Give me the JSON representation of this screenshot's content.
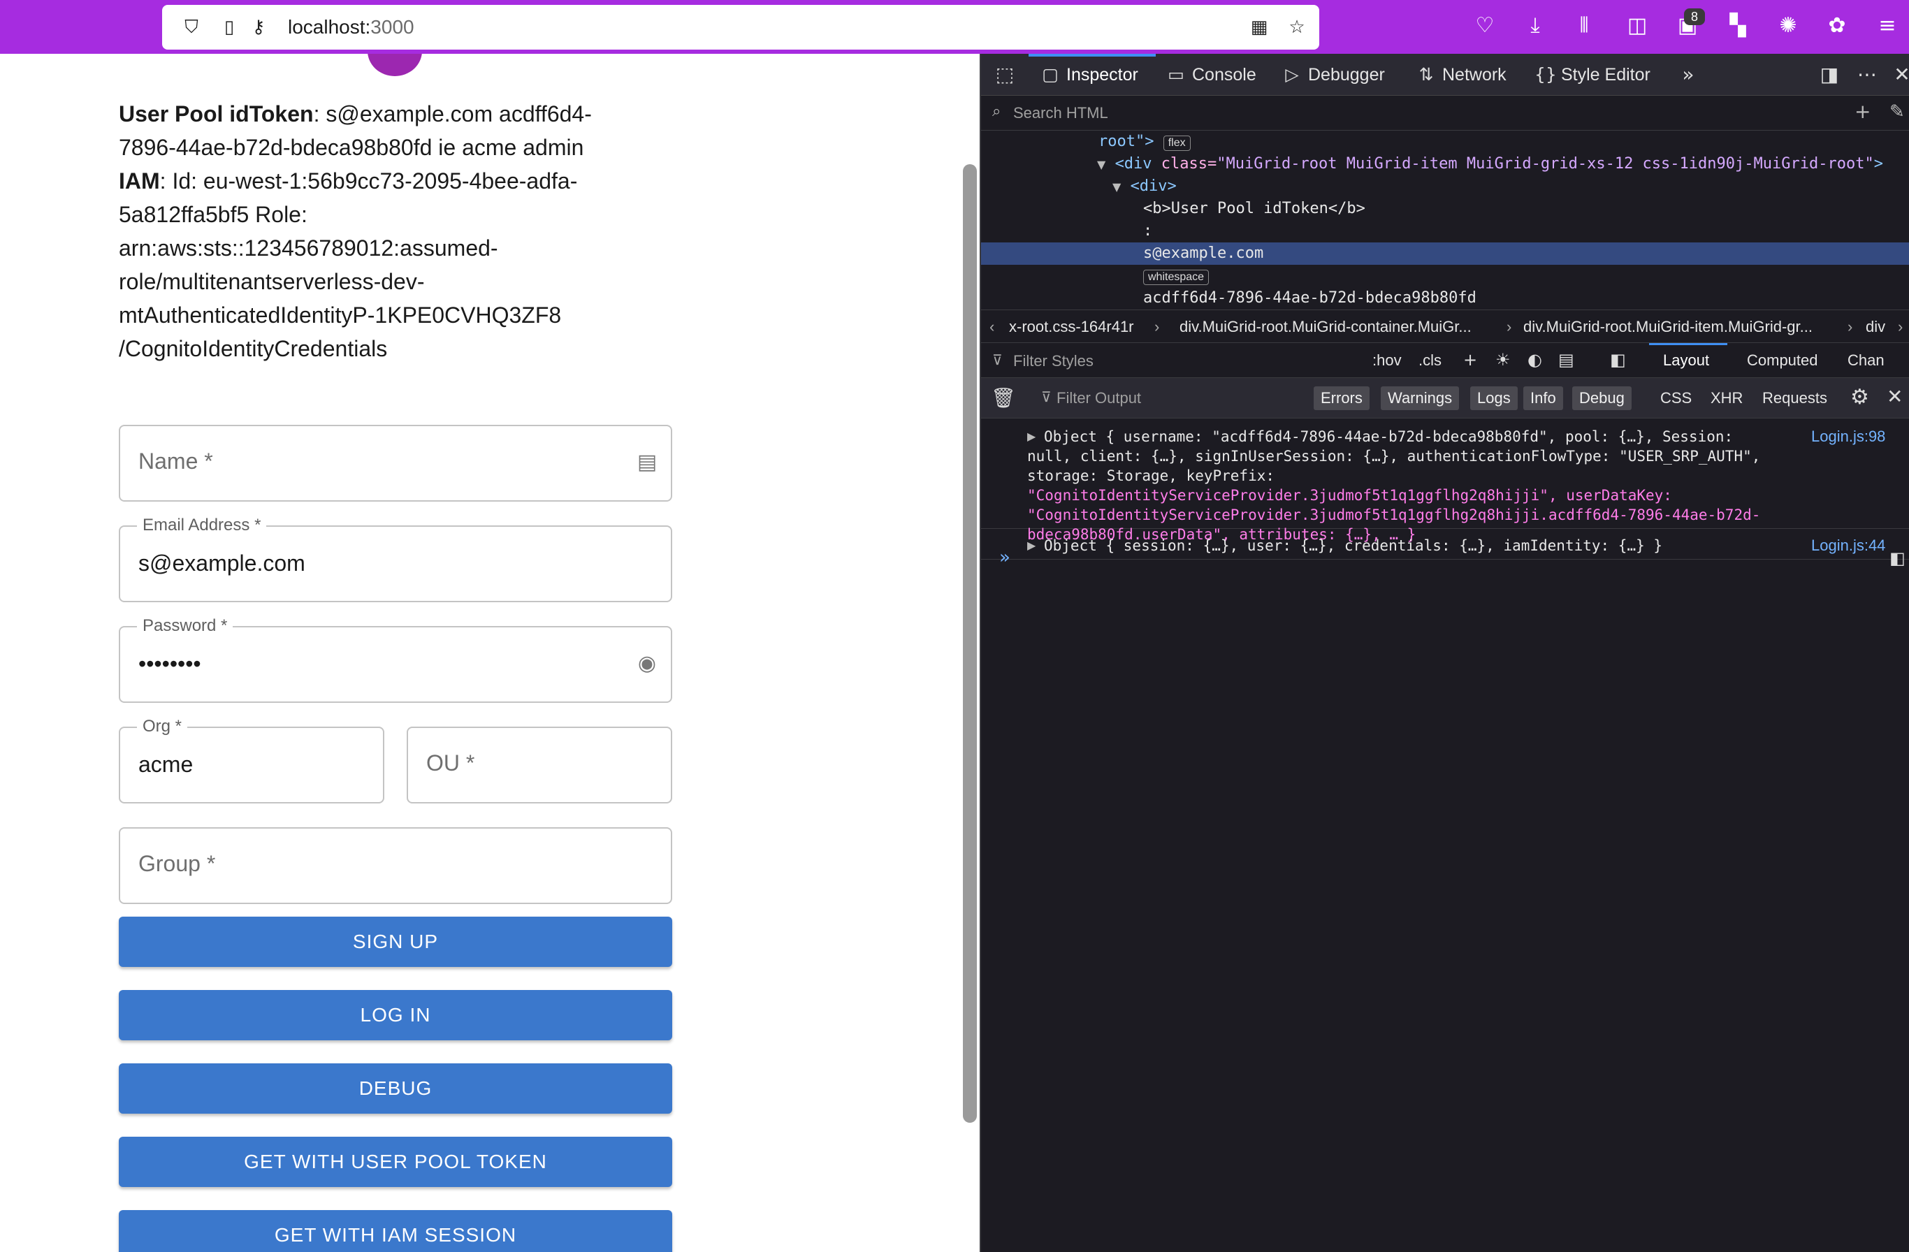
{
  "browser": {
    "url_host": "localhost:",
    "url_port": "3000",
    "notification_count": "8"
  },
  "page": {
    "info": {
      "idtoken_label": "User Pool idToken",
      "idtoken_value": ": s@example.com acdff6d4-7896-44ae-b72d-bdeca98b80fd ie acme admin",
      "iam_label": "IAM",
      "iam_value": ": Id: eu-west-1:56b9cc73-2095-4bee-adfa-5a812ffa5bf5 Role: arn:aws:sts::123456789012:assumed-role/multitenantserverless-dev-mtAuthenticatedIdentityP-1KPE0CVHQ3ZF8 /CognitoIdentityCredentials"
    },
    "form": {
      "name_placeholder": "Name *",
      "email_label": "Email Address *",
      "email_value": "s@example.com",
      "password_label": "Password *",
      "password_value": "••••••••",
      "org_label": "Org *",
      "org_value": "acme",
      "ou_placeholder": "OU *",
      "group_placeholder": "Group *"
    },
    "buttons": {
      "sign_up": "SIGN UP",
      "log_in": "LOG IN",
      "debug": "DEBUG",
      "get_user_pool": "GET WITH USER POOL TOKEN",
      "get_iam": "GET WITH IAM SESSION"
    }
  },
  "devtools": {
    "tabs": [
      "Inspector",
      "Console",
      "Debugger",
      "Network",
      "Style Editor"
    ],
    "search_placeholder": "Search HTML",
    "markup": {
      "root_frag": "root\">",
      "flex_badge": "flex",
      "div_open_tag": "<div ",
      "div_class_attr": "class=",
      "div_class_val": "\"MuiGrid-root MuiGrid-item MuiGrid-grid-xs-12 css-1idn90j-MuiGrid-root\"",
      "div_close": ">",
      "inner_div": "<div>",
      "b_line": "<b>User Pool idToken</b>",
      "colon": ":",
      "selected_text": "s@example.com",
      "whitespace_badge": "whitespace",
      "uuid_text": "acdff6d4-7896-44ae-b72d-bdeca98b80fd"
    },
    "breadcrumbs": [
      "x-root.css-164r41r",
      "div.MuiGrid-root.MuiGrid-container.MuiGr...",
      "div.MuiGrid-root.MuiGrid-item.MuiGrid-gr...",
      "div"
    ],
    "filter_styles_placeholder": "Filter Styles",
    "rules_hov": ":hov",
    "rules_cls": ".cls",
    "rules_tabs": [
      "Layout",
      "Computed",
      "Chan"
    ],
    "console_filter_placeholder": "Filter Output",
    "console_levels": [
      "Errors",
      "Warnings",
      "Logs",
      "Info",
      "Debug"
    ],
    "console_types": [
      "CSS",
      "XHR",
      "Requests"
    ],
    "console_messages": [
      {
        "source": "Login.js:98",
        "lines": [
          "Object { username: \"acdff6d4-7896-44ae-b72d-bdeca98b80fd\", pool: {…}, Session:",
          "null, client: {…}, signInUserSession: {…}, authenticationFlowType: \"USER_SRP_AUTH\",",
          "storage: Storage, keyPrefix:",
          "\"CognitoIdentityServiceProvider.3judmof5t1q1ggflhg2q8hijji\", userDataKey:",
          "\"CognitoIdentityServiceProvider.3judmof5t1q1ggflhg2q8hijji.acdff6d4-7896-44ae-b72d-",
          "bdeca98b80fd.userData\", attributes: {…}, … }"
        ]
      },
      {
        "source": "Login.js:44",
        "lines": [
          "Object { session: {…}, user: {…}, credentials: {…}, iamIdentity: {…} }"
        ]
      }
    ]
  }
}
